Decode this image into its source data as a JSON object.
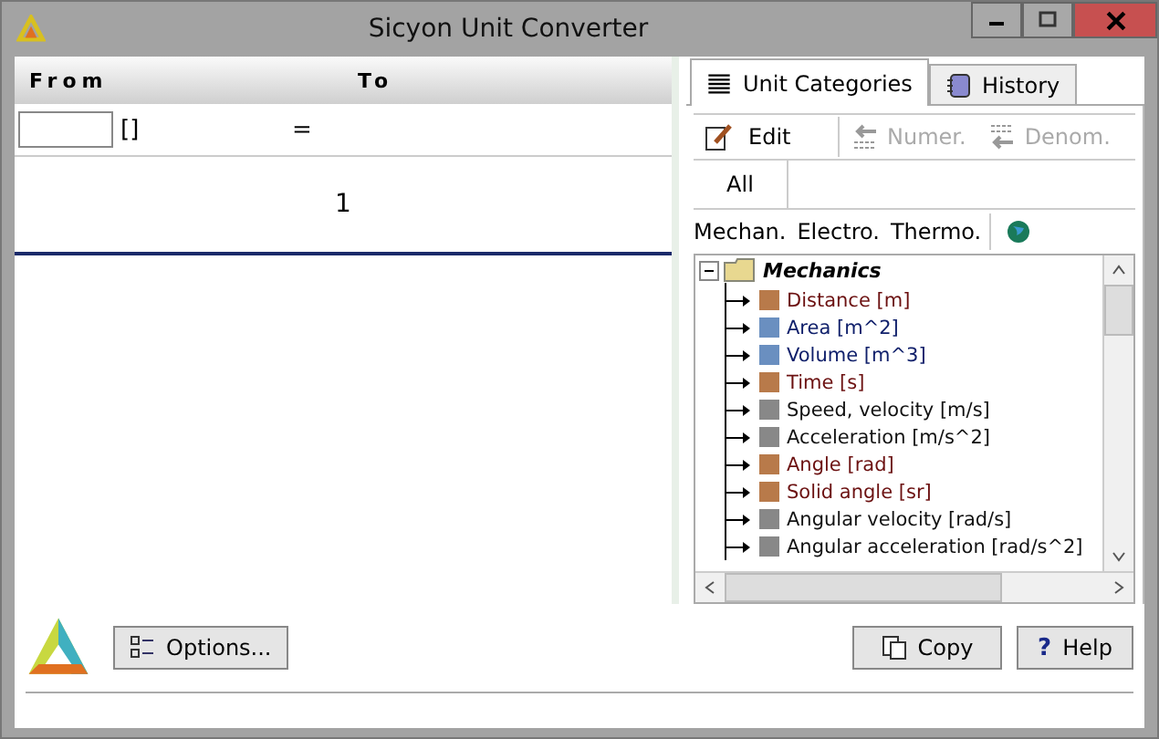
{
  "window": {
    "title": "Sicyon Unit Converter"
  },
  "converter": {
    "from_label": "From",
    "to_label": "To",
    "unit": "[]",
    "equals": "=",
    "result": "1"
  },
  "tabs": [
    {
      "label": "Unit Categories",
      "selected": true
    },
    {
      "label": "History",
      "selected": false
    }
  ],
  "toolbar": [
    {
      "label": "Edit",
      "disabled": false
    },
    {
      "label": "Numer.",
      "disabled": true
    },
    {
      "label": "Denom.",
      "disabled": true
    }
  ],
  "filter": {
    "label": "All"
  },
  "groups": [
    "Mechan.",
    "Electro.",
    "Thermo."
  ],
  "tree": {
    "label": "Mechanics",
    "expanded": true,
    "children": [
      {
        "label": "Distance [m]",
        "color": "#b87a4a"
      },
      {
        "label": "Area [m^2]",
        "color": "#6a8fc0"
      },
      {
        "label": "Volume [m^3]",
        "color": "#6a8fc0"
      },
      {
        "label": "Time [s]",
        "color": "#b87a4a"
      },
      {
        "label": "Speed, velocity [m/s]",
        "color": "#888888"
      },
      {
        "label": "Acceleration [m/s^2]",
        "color": "#888888"
      },
      {
        "label": "Angle [rad]",
        "color": "#b87a4a"
      },
      {
        "label": "Solid angle [sr]",
        "color": "#b87a4a"
      },
      {
        "label": "Angular velocity [rad/s]",
        "color": "#888888"
      },
      {
        "label": "Angular acceleration [rad/s^2]",
        "color": "#888888"
      }
    ]
  },
  "buttons": [
    {
      "label": "Options...",
      "kind": "options"
    },
    {
      "label": "Copy",
      "kind": "copy"
    },
    {
      "label": "Help",
      "kind": "help",
      "icon_text": "?"
    }
  ]
}
